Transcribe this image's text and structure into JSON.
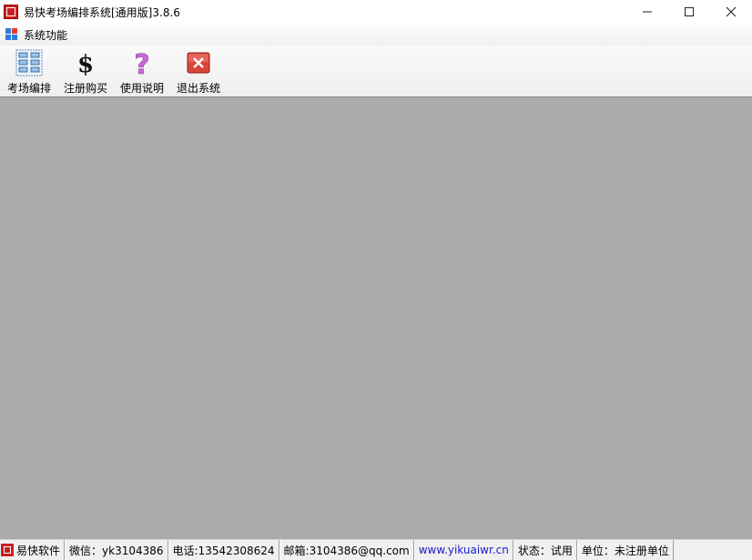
{
  "window": {
    "title": "易快考场编排系统[通用版]3.8.6",
    "controls": [
      "minimize",
      "maximize",
      "close"
    ]
  },
  "menu": {
    "items": [
      {
        "label": "系统功能",
        "icon": "windows-grid-icon"
      }
    ]
  },
  "toolbar": {
    "items": [
      {
        "label": "考场编排",
        "icon": "seating-grid-icon"
      },
      {
        "label": "注册购买",
        "icon": "dollar-icon"
      },
      {
        "label": "使用说明",
        "icon": "question-icon"
      },
      {
        "label": "退出系统",
        "icon": "exit-x-icon"
      }
    ]
  },
  "statusbar": {
    "company": "易快软件",
    "wechat": "微信：yk3104386",
    "phone": "电话:13542308624",
    "email": "邮箱:3104386@qq.com",
    "website": "www.yikuaiwr.cn",
    "status": "状态：试用",
    "unit": "单位：未注册单位"
  },
  "colors": {
    "workspace": "#ababab",
    "link": "#1a1acc",
    "app_icon_red": "#c82020"
  }
}
